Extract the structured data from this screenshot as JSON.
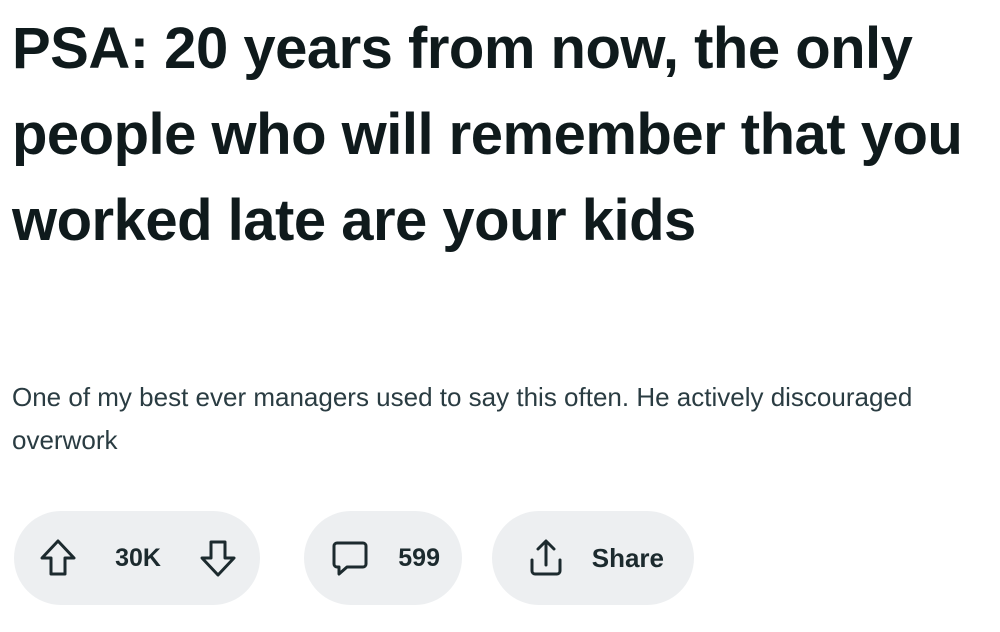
{
  "post": {
    "title": "PSA: 20 years from now, the only people who will remember that you worked late are your kids",
    "body": "One of my best ever managers used to say this often. He actively discouraged overwork"
  },
  "actions": {
    "vote_count": "30K",
    "comment_count": "599",
    "share_label": "Share",
    "icons": {
      "upvote": "arrow-up-icon",
      "downvote": "arrow-down-icon",
      "comments": "speech-bubble-icon",
      "share": "share-upload-icon"
    }
  },
  "colors": {
    "pill_background": "#edeff1",
    "title_text": "#0f1a1c",
    "body_text": "#2a3c42"
  }
}
